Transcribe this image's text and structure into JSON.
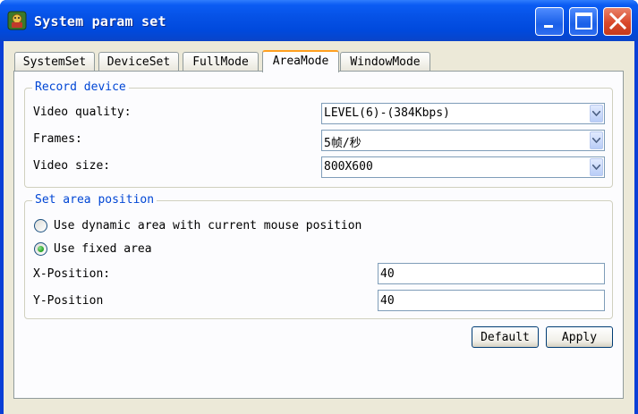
{
  "window": {
    "title": "System param set",
    "colors": {
      "titlebar": "#0652e6",
      "close": "#d9482a",
      "face": "#ece9d8"
    }
  },
  "titlebar_buttons": {
    "minimize": "minimize-icon",
    "maximize": "maximize-icon",
    "close": "close-icon"
  },
  "tabs": [
    {
      "label": "SystemSet"
    },
    {
      "label": "DeviceSet"
    },
    {
      "label": "FullMode"
    },
    {
      "label": "AreaMode",
      "selected": true
    },
    {
      "label": "WindowMode"
    }
  ],
  "record_device": {
    "title": "Record device",
    "video_quality": {
      "label": "Video quality:",
      "value": "LEVEL(6)-(384Kbps)"
    },
    "frames": {
      "label": "Frames:",
      "value": "5帧/秒"
    },
    "video_size": {
      "label": "Video size:",
      "value": "800X600"
    }
  },
  "area_position": {
    "title": "Set area position",
    "option_dynamic": {
      "label": "Use dynamic area with current mouse position",
      "checked": false
    },
    "option_fixed": {
      "label": "Use fixed area",
      "checked": true
    },
    "x_position": {
      "label": "X-Position:",
      "value": "40"
    },
    "y_position": {
      "label": "Y-Position",
      "value": "40"
    }
  },
  "buttons": {
    "default": "Default",
    "apply": "Apply"
  }
}
